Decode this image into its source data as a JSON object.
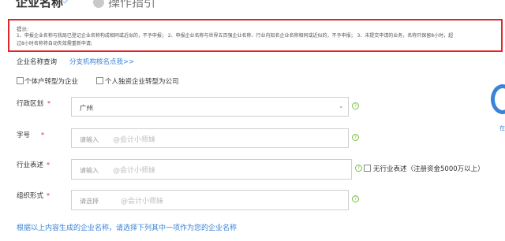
{
  "tabs": {
    "name_tab": "企业名称",
    "guide_tab": "操作指引"
  },
  "notice": {
    "head": "提示:",
    "line1": "1、申报企业名称与我局已登记企业名称构成相同或近似的，不予申报；  2、申报企业名称与世界五百强企业名称、行业内知名企业名称相同或近似的，不予申报；  3、未提交申请的业务，名称只保留8小时，超",
    "line2": "过8小时名称将自动失效需重新申请;"
  },
  "query": {
    "label": "企业名称查询",
    "link": "分支机构核名点我>>"
  },
  "checkboxes": [
    {
      "label": "个体户转型为企业"
    },
    {
      "label": "个人独资企业转型为公司"
    }
  ],
  "form": {
    "region": {
      "label": "行政区划",
      "value": "广州"
    },
    "zihao": {
      "label": "字号",
      "placeholder": "请输入",
      "watermark": "@会计小师妹"
    },
    "industry": {
      "label": "行业表述",
      "placeholder": "请输入",
      "watermark": "@会计小师妹",
      "no_industry_label": "无行业表述（注册资金5000万以上）"
    },
    "org_form": {
      "label": "组织形式",
      "placeholder": "请选择",
      "watermark": "@会计小师妹"
    },
    "required_mark": "*",
    "help_glyph": "?"
  },
  "bottom_note": "根据以上内容生成的企业名称，请选择下列其中一项作为您的企业名称",
  "side_widget": {
    "text": "在"
  },
  "colors": {
    "accent": "#3a83d6",
    "alert": "#e1252b",
    "help": "#7bc043"
  }
}
